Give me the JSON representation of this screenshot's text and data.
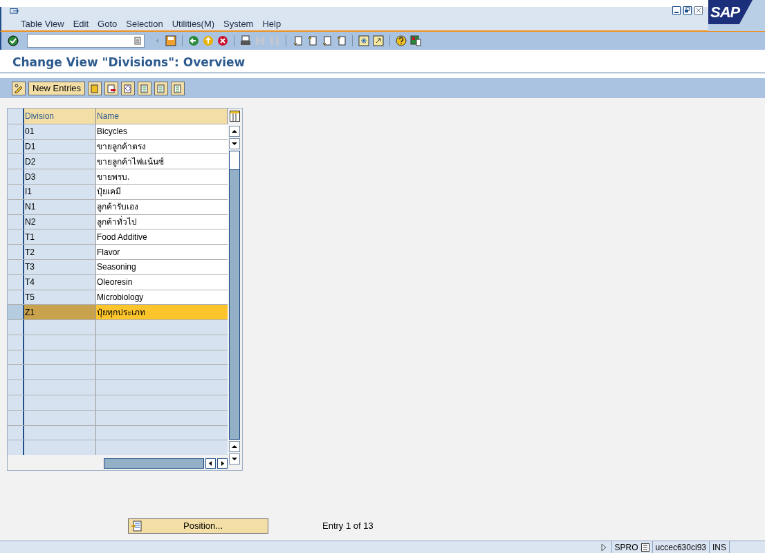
{
  "menu_bar": {
    "items": [
      "Table View",
      "Edit",
      "Goto",
      "Selection",
      "Utilities(M)",
      "System",
      "Help"
    ]
  },
  "logo": {
    "text": "SAP"
  },
  "title": "Change View \"Divisions\": Overview",
  "app_toolbar": {
    "new_entries_button": "New Entries"
  },
  "table": {
    "columns": [
      "Division",
      "Name"
    ],
    "rows": [
      {
        "division": "01",
        "name": "Bicycles",
        "selected": false
      },
      {
        "division": "D1",
        "name": "ขายลูกค้าตรง",
        "selected": false
      },
      {
        "division": "D2",
        "name": "ขายลูกค้าไฟแน้นซ์",
        "selected": false
      },
      {
        "division": "D3",
        "name": "ขายพรบ.",
        "selected": false
      },
      {
        "division": "I1",
        "name": "ปุ๋ยเคมี",
        "selected": false
      },
      {
        "division": "N1",
        "name": "ลูกค้ารับเอง",
        "selected": false
      },
      {
        "division": "N2",
        "name": "ลูกค้าทั่วไป",
        "selected": false
      },
      {
        "division": "T1",
        "name": "Food Additive",
        "selected": false
      },
      {
        "division": "T2",
        "name": "Flavor",
        "selected": false
      },
      {
        "division": "T3",
        "name": "Seasoning",
        "selected": false
      },
      {
        "division": "T4",
        "name": "Oleoresin",
        "selected": false
      },
      {
        "division": "T5",
        "name": "Microbiology",
        "selected": false
      },
      {
        "division": "Z1",
        "name": "ปุ๋ยทุกประเภท",
        "selected": true
      }
    ]
  },
  "footer": {
    "position_button": "Position...",
    "entry_info": "Entry 1 of 13"
  },
  "status_bar": {
    "transaction": "SPRO",
    "server": "uccec630ci93",
    "mode": "INS"
  }
}
